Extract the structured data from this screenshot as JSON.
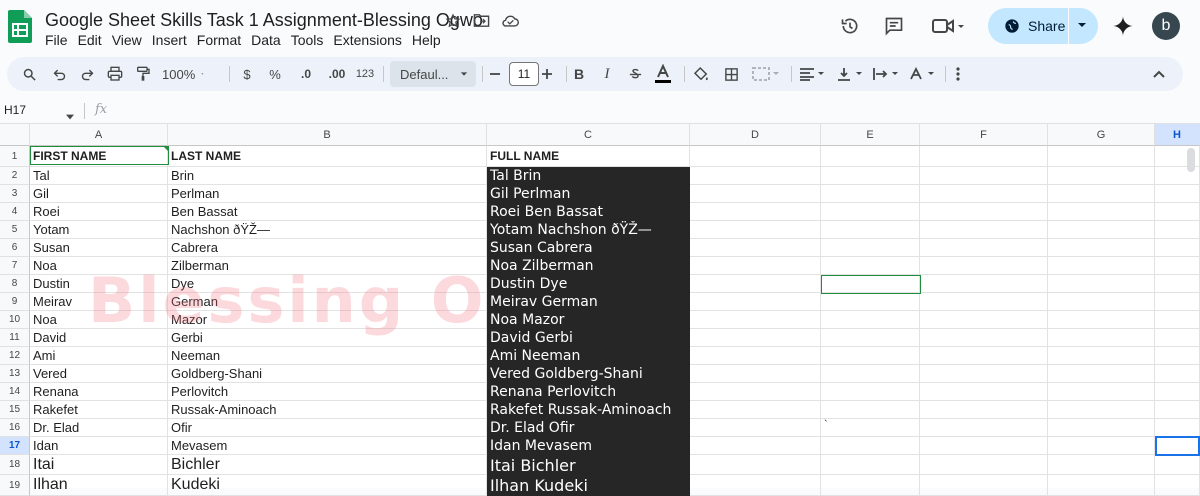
{
  "app": {
    "doc_title": "Google Sheet Skills Task 1 Assignment-Blessing Ogwo",
    "menu": [
      "File",
      "Edit",
      "View",
      "Insert",
      "Format",
      "Data",
      "Tools",
      "Extensions",
      "Help"
    ],
    "share_label": "Share",
    "avatar_letter": "b",
    "accent": "#0f9d58"
  },
  "toolbar": {
    "zoom": "100%",
    "currency": "$",
    "percent": "%",
    "dec_decrease": ".0",
    "dec_increase": ".00",
    "number_format": "123",
    "font": "Defaul...",
    "font_size": "11",
    "bold": "B",
    "italic": "I"
  },
  "formula_bar": {
    "name_box": "H17",
    "fx": "fx",
    "content": ""
  },
  "sheet": {
    "columns": [
      "A",
      "B",
      "C",
      "D",
      "E",
      "F",
      "G",
      "H"
    ],
    "selected_column": "H",
    "selected_row": "17",
    "rows": [
      {
        "n": "1",
        "a": "FIRST NAME",
        "b": "LAST NAME",
        "c": "FULL NAME"
      },
      {
        "n": "2",
        "a": "Tal",
        "b": "Brin",
        "c": "Tal Brin"
      },
      {
        "n": "3",
        "a": "Gil",
        "b": "Perlman",
        "c": "Gil Perlman"
      },
      {
        "n": "4",
        "a": "Roei",
        "b": "Ben Bassat",
        "c": "Roei Ben Bassat"
      },
      {
        "n": "5",
        "a": "Yotam",
        "b": "Nachshon ðŸŽ—",
        "c": "Yotam Nachshon ðŸŽ—"
      },
      {
        "n": "6",
        "a": "Susan",
        "b": "Cabrera",
        "c": "Susan Cabrera"
      },
      {
        "n": "7",
        "a": "Noa",
        "b": "Zilberman",
        "c": "Noa Zilberman"
      },
      {
        "n": "8",
        "a": "Dustin",
        "b": "Dye",
        "c": "Dustin Dye"
      },
      {
        "n": "9",
        "a": "Meirav",
        "b": "German",
        "c": "Meirav German"
      },
      {
        "n": "10",
        "a": "Noa",
        "b": "Mazor",
        "c": "Noa Mazor"
      },
      {
        "n": "11",
        "a": "David",
        "b": "Gerbi",
        "c": "David Gerbi"
      },
      {
        "n": "12",
        "a": "Ami",
        "b": "Neeman",
        "c": "Ami Neeman"
      },
      {
        "n": "13",
        "a": "Vered",
        "b": "Goldberg-Shani",
        "c": "Vered Goldberg-Shani"
      },
      {
        "n": "14",
        "a": "Renana",
        "b": "Perlovitch",
        "c": "Renana Perlovitch"
      },
      {
        "n": "15",
        "a": "Rakefet",
        "b": "Russak-Aminoach",
        "c": "Rakefet Russak-Aminoach"
      },
      {
        "n": "16",
        "a": " Dr. Elad",
        "b": "Ofir",
        "c": " Dr. Elad Ofir",
        "e": "`"
      },
      {
        "n": "17",
        "a": "Idan",
        "b": "Mevasem",
        "c": "Idan Mevasem"
      },
      {
        "n": "18",
        "a": "Itai",
        "b": "Bichler",
        "c": "Itai Bichler"
      },
      {
        "n": "19",
        "a": "Ilhan",
        "b": "Kudeki",
        "c": "Ilhan Kudeki"
      }
    ],
    "watermark": "Blessing O"
  }
}
